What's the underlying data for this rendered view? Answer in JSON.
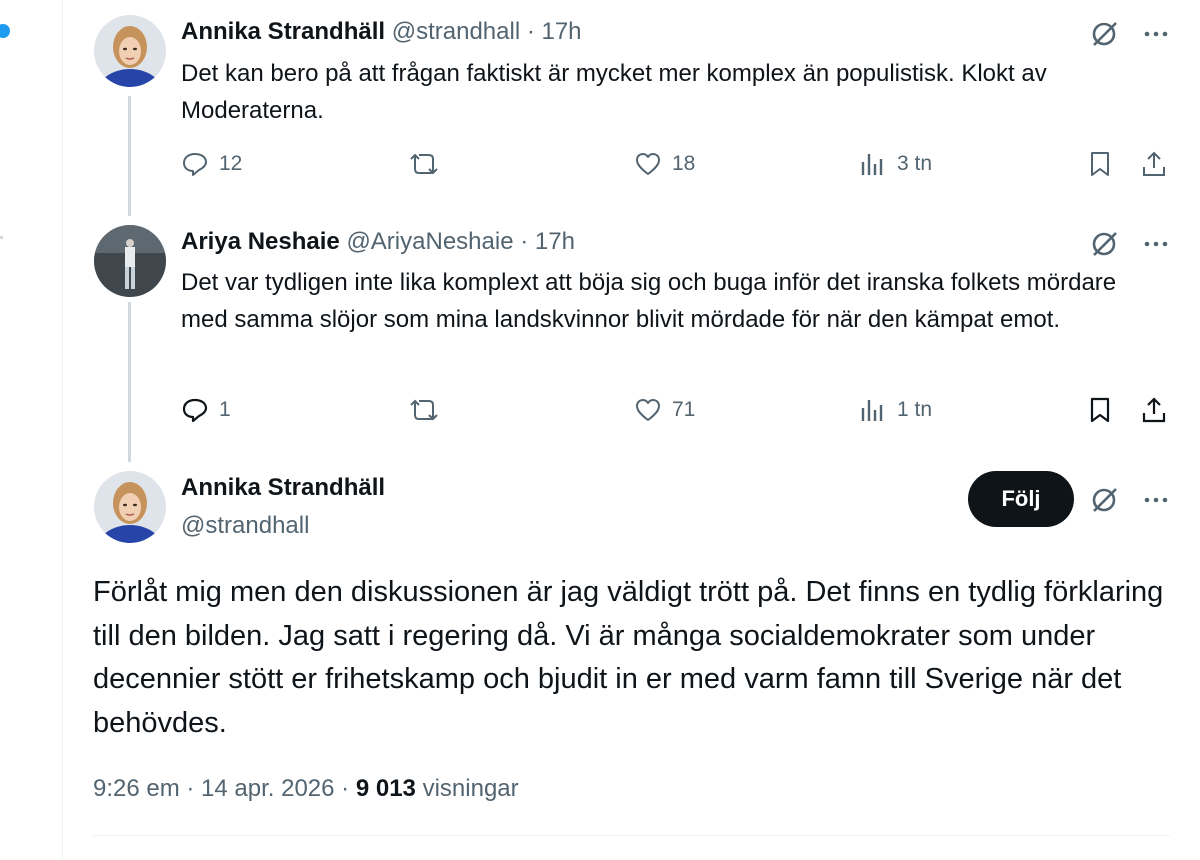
{
  "replies": [
    {
      "name": "Annika Strandhäll",
      "handle": "@strandhall",
      "time": "· 17h",
      "text": "Det kan bero på att frågan faktiskt är mycket mer komplex än populistisk. Klokt av Moderaterna.",
      "actions": {
        "replies": "12",
        "retweets": "",
        "likes": "18",
        "views": "3 tn"
      },
      "icons": [
        "grok-icon",
        "more-icon",
        "reply-icon",
        "retweet-icon",
        "like-icon",
        "views-icon",
        "bookmark-icon",
        "share-icon"
      ]
    },
    {
      "name": "Ariya Neshaie",
      "handle": "@AriyaNeshaie",
      "time": "· 17h",
      "text": "Det var tydligen inte lika komplext att böja sig och buga inför det iranska folkets mördare med samma slöjor som mina landskvinnor blivit mördade för när den kämpat emot.",
      "actions": {
        "replies": "1",
        "retweets": "",
        "likes": "71",
        "views": "1 tn"
      },
      "icons": [
        "grok-icon",
        "more-icon",
        "reply-icon",
        "retweet-icon",
        "like-icon",
        "views-icon",
        "bookmark-icon",
        "share-icon"
      ]
    }
  ],
  "main": {
    "name": "Annika Strandhäll",
    "handle": "@strandhall",
    "follow_label": "Följ",
    "text": "Förlåt mig men den diskussionen är jag väldigt trött på. Det finns en tydlig förklaring till den bilden. Jag satt i regering då.  Vi är många socialdemokrater som under decennier stött er frihetskamp och bjudit in er med varm famn till Sverige när det behövdes.",
    "time": "9:26 em",
    "date": "· 14 apr. 2026 ·",
    "views_count": "9 013",
    "views_label": "visningar"
  },
  "colors": {
    "text": "#0f1419",
    "muted": "#536471",
    "accent": "#1d9bf0",
    "line": "#cfd9de",
    "button_bg": "#0f1419"
  }
}
